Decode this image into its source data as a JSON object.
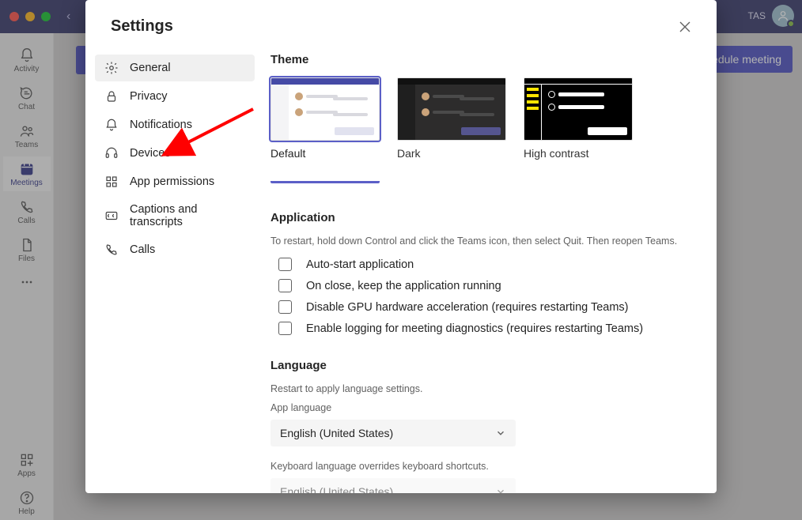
{
  "titlebar": {
    "initials": "TAS"
  },
  "rail": {
    "items": [
      {
        "key": "activity",
        "label": "Activity"
      },
      {
        "key": "chat",
        "label": "Chat"
      },
      {
        "key": "teams",
        "label": "Teams"
      },
      {
        "key": "meetings",
        "label": "Meetings"
      },
      {
        "key": "calls",
        "label": "Calls"
      },
      {
        "key": "files",
        "label": "Files"
      }
    ],
    "apps_label": "Apps",
    "help_label": "Help"
  },
  "schedule_button": "Schedule meeting",
  "dialog": {
    "title": "Settings",
    "nav": [
      {
        "key": "general",
        "label": "General"
      },
      {
        "key": "privacy",
        "label": "Privacy"
      },
      {
        "key": "notifications",
        "label": "Notifications"
      },
      {
        "key": "devices",
        "label": "Devices"
      },
      {
        "key": "app-permissions",
        "label": "App permissions"
      },
      {
        "key": "captions",
        "label": "Captions and transcripts"
      },
      {
        "key": "calls",
        "label": "Calls"
      }
    ],
    "theme": {
      "heading": "Theme",
      "options": [
        {
          "key": "default",
          "label": "Default"
        },
        {
          "key": "dark",
          "label": "Dark"
        },
        {
          "key": "high-contrast",
          "label": "High contrast"
        }
      ]
    },
    "application": {
      "heading": "Application",
      "hint": "To restart, hold down Control and click the Teams icon, then select Quit. Then reopen Teams.",
      "options": [
        "Auto-start application",
        "On close, keep the application running",
        "Disable GPU hardware acceleration (requires restarting Teams)",
        "Enable logging for meeting diagnostics (requires restarting Teams)"
      ]
    },
    "language": {
      "heading": "Language",
      "hint": "Restart to apply language settings.",
      "app_label": "App language",
      "app_value": "English (United States)",
      "kb_label": "Keyboard language overrides keyboard shortcuts.",
      "kb_value": "English (United States)"
    }
  }
}
